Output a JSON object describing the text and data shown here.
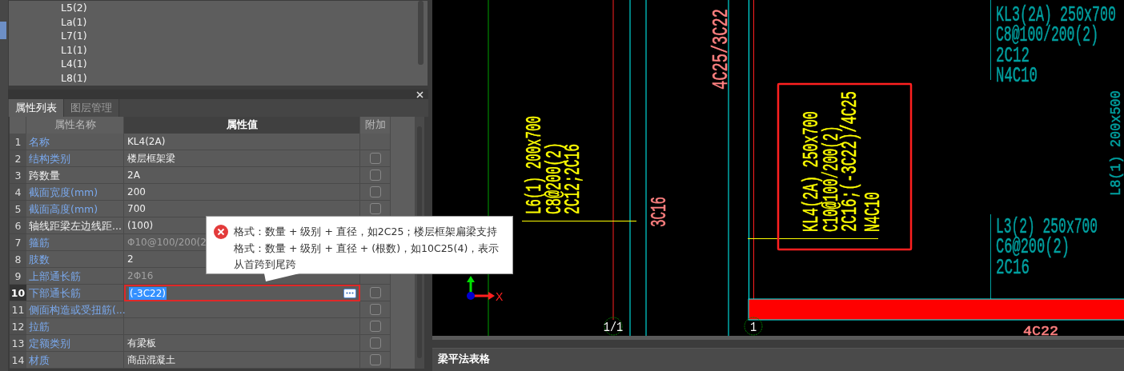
{
  "tree": {
    "items": [
      "L5(2)",
      "La(1)",
      "L7(1)",
      "L1(1)",
      "L4(1)",
      "L8(1)"
    ]
  },
  "properties": {
    "tabs": [
      {
        "label": "属性列表",
        "selected": true
      },
      {
        "label": "图层管理",
        "selected": false
      }
    ],
    "columns": [
      "属性名称",
      "属性值",
      "附加"
    ],
    "rows": [
      {
        "index": "1",
        "name": "名称",
        "value": "KL4(2A)",
        "public": true,
        "greyed": false,
        "selected": false
      },
      {
        "index": "2",
        "name": "结构类别",
        "value": "楼层框架梁",
        "public": true,
        "greyed": false,
        "checked": false,
        "selected": false
      },
      {
        "index": "3",
        "name": "跨数量",
        "value": "2A",
        "public": false,
        "greyed": false,
        "checked": false,
        "selected": false
      },
      {
        "index": "4",
        "name": "截面宽度(mm)",
        "value": "200",
        "public": true,
        "greyed": false,
        "checked": false,
        "selected": false
      },
      {
        "index": "5",
        "name": "截面高度(mm)",
        "value": "700",
        "public": true,
        "greyed": false,
        "checked": false,
        "selected": false
      },
      {
        "index": "6",
        "name": "轴线距梁左边线距...",
        "value": "(100)",
        "public": false,
        "greyed": false,
        "selected": false
      },
      {
        "index": "7",
        "name": "箍筋",
        "value": "Φ10@100/200(2",
        "public": true,
        "greyed": true,
        "selected": false
      },
      {
        "index": "8",
        "name": "肢数",
        "value": "2",
        "public": true,
        "greyed": false,
        "selected": false
      },
      {
        "index": "9",
        "name": "上部通长筋",
        "value": "2Φ16",
        "public": true,
        "greyed": true,
        "selected": false
      },
      {
        "index": "10",
        "name": "下部通长筋",
        "value": "(-3C22)",
        "public": true,
        "greyed": false,
        "checked": false,
        "selected": true
      },
      {
        "index": "11",
        "name": "侧面构造或受扭筋(...",
        "public": true,
        "checked": false,
        "selected": false
      },
      {
        "index": "12",
        "name": "拉筋",
        "public": true,
        "checked": false,
        "selected": false
      },
      {
        "index": "13",
        "name": "定额类别",
        "value": "有梁板",
        "public": true,
        "greyed": false,
        "checked": false,
        "selected": false
      },
      {
        "index": "14",
        "name": "材质",
        "value": "商品混凝土",
        "public": true,
        "greyed": false,
        "checked": false,
        "selected": false
      }
    ],
    "tooltip": {
      "text": "格式：数量 + 级别 + 直径，如2C25；楼层框架扁梁支持格式：数量 + 级别 + 直径 + (根数)，如10C25(4)，表示从首跨到尾跨"
    }
  },
  "drawing": {
    "labels": [
      {
        "text": "L6(1) 200x700",
        "color": "#ffff00",
        "kind": "vertical"
      },
      {
        "text": "C8@200(2)",
        "color": "#ffff00",
        "kind": "vertical"
      },
      {
        "text": "2C12;2C16",
        "color": "#ffff00",
        "kind": "vertical"
      },
      {
        "text": "3C16",
        "color": "#ff8080",
        "kind": "vertical"
      },
      {
        "text": "4C25/3C22",
        "color": "#ff8080",
        "kind": "vertical"
      },
      {
        "text": "KL4(2A) 250x700",
        "color": "#ffff00",
        "kind": "vertical"
      },
      {
        "text": "C10@100/200(2)",
        "color": "#ffff00",
        "kind": "vertical"
      },
      {
        "text": "2C16;(-3C22)/4C25",
        "color": "#ffff00",
        "kind": "vertical"
      },
      {
        "text": "N4C10",
        "color": "#ffff00",
        "kind": "vertical"
      },
      {
        "text": "KL3(2A) 250x700",
        "color": "#00a0a0",
        "kind": "horizontal"
      },
      {
        "text": "C8@100/200(2)",
        "color": "#00a0a0",
        "kind": "horizontal"
      },
      {
        "text": "2C12",
        "color": "#00a0a0",
        "kind": "horizontal"
      },
      {
        "text": "N4C10",
        "color": "#00a0a0",
        "kind": "horizontal"
      },
      {
        "text": "L8(1) 200x500",
        "color": "#00a0a0",
        "kind": "vertical"
      },
      {
        "text": "L3(2) 250x700",
        "color": "#00a0a0",
        "kind": "horizontal"
      },
      {
        "text": "C6@200(2)",
        "color": "#00a0a0",
        "kind": "horizontal"
      },
      {
        "text": "2C16",
        "color": "#00a0a0",
        "kind": "horizontal"
      },
      {
        "text": "4C22",
        "color": "#ff8080",
        "kind": "horizontal"
      }
    ],
    "grid_labels": [
      "1/1",
      "1"
    ],
    "axis_label": "X"
  },
  "bottom_panel": {
    "title": "梁平法表格"
  }
}
